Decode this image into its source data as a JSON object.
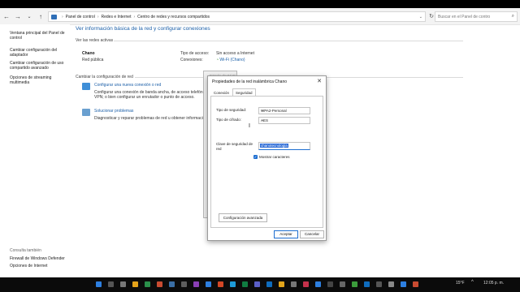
{
  "address": {
    "crumbs": [
      "Panel de control",
      "Redes e Internet",
      "Centro de redes y recursos compartidos"
    ],
    "search_placeholder": "Buscar en el Panel de contro"
  },
  "sidebar": {
    "items": [
      "Ventana principal del Panel de control",
      "Cambiar configuración del adaptador",
      "Cambiar configuración de uso compartido avanzado",
      "Opciones de streaming multimedia"
    ],
    "see_also": "Consulta también",
    "see_also_items": [
      "Firewall de Windows Defender",
      "Opciones de Internet"
    ]
  },
  "main": {
    "title": "Ver información básica de la red y configurar conexiones",
    "active_networks_label": "Ver las redes activas",
    "network_name": "Chano",
    "network_type": "Red pública",
    "access_type_label": "Tipo de acceso:",
    "access_type_value": "Sin acceso a Internet",
    "connections_label": "Conexiones:",
    "connections_value": "Wi-Fi (Chano)",
    "change_settings_label": "Cambiar la configuración de red",
    "tasks": [
      {
        "link": "Configurar una nueva conexión o red",
        "desc": "Configurar una conexión de banda ancha, de acceso telefónico o VPN; o bien configurar un enrutador o punto de acceso."
      },
      {
        "link": "Solucionar problemas",
        "desc": "Diagnosticar y reparar problemas de red u obtener información"
      }
    ]
  },
  "back_window_title": "Estado de Wi-Fi",
  "dialog": {
    "title": "Propiedades de la red inalámbrica Chano",
    "close": "✕",
    "tabs": [
      "Conexión",
      "Seguridad"
    ],
    "security_type_label": "Tipo de seguridad:",
    "security_type_value": "WPA2-Personal",
    "encryption_label": "Tipo de cifrado:",
    "encryption_value": "AES",
    "key_label": "Clave de seguridad de red",
    "key_value": "chanotecnologia",
    "show_chars_label": "Mostrar caracteres",
    "advanced_button": "Configuración avanzada",
    "ok_button": "Aceptar",
    "cancel_button": "Cancelar"
  },
  "taskbar": {
    "weather": "15°F",
    "time": "12:05 p. m."
  },
  "colors": {
    "link": "#1b5fa8",
    "accent": "#1f6fd1"
  }
}
